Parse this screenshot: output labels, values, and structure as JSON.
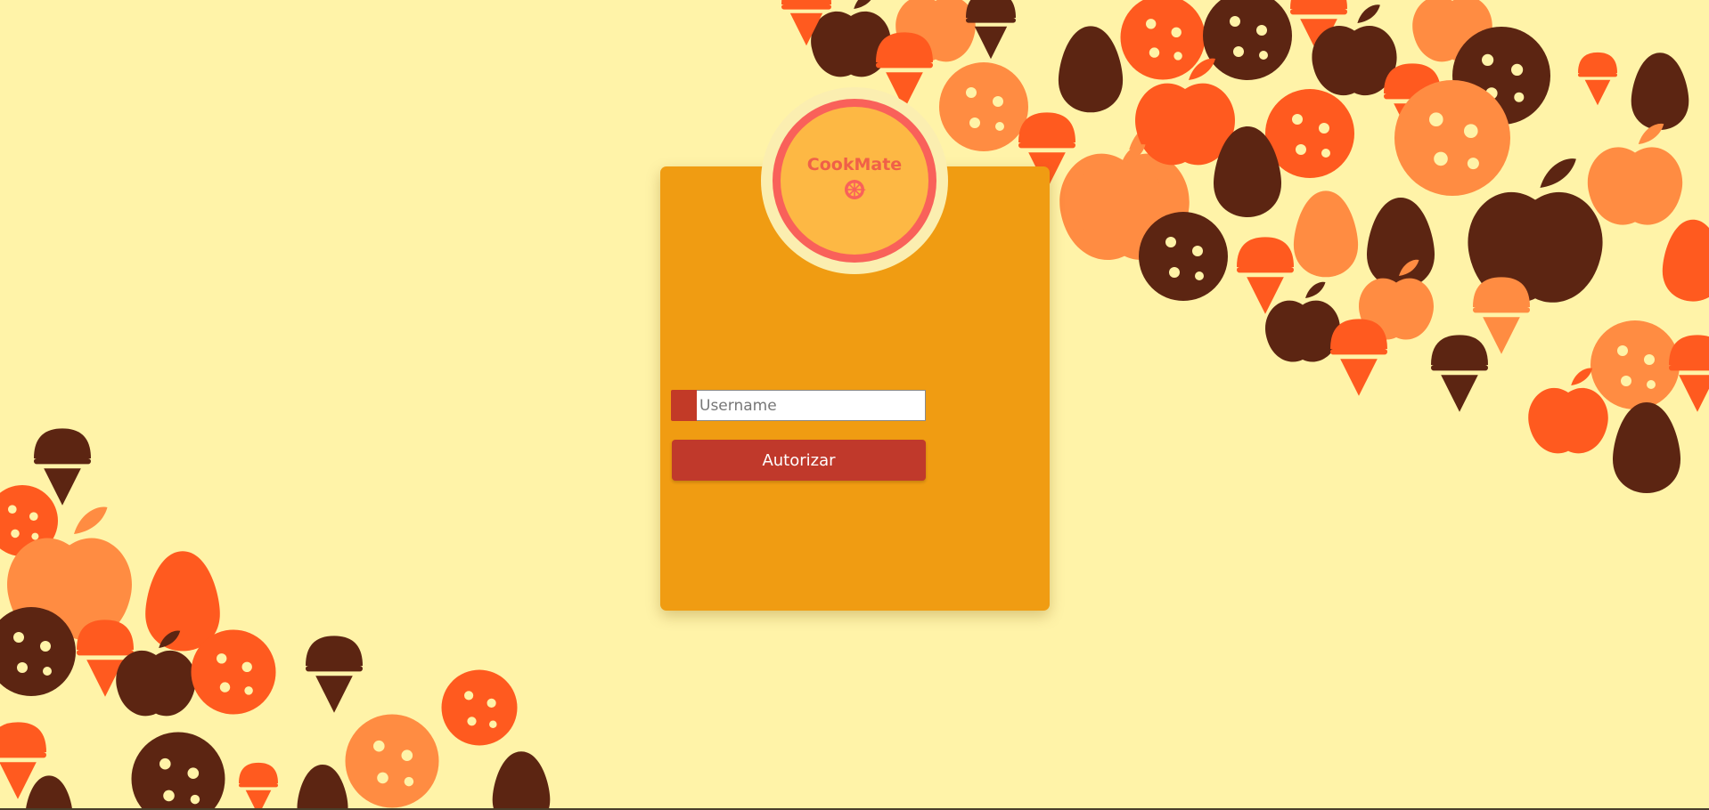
{
  "app": {
    "logo_text": "CookMate",
    "logo_icon": "lemon-slice-icon"
  },
  "login": {
    "username_placeholder": "Username",
    "username_value": "",
    "submit_label": "Autorizar"
  },
  "colors": {
    "background": "#fff3a8",
    "card": "#f09c12",
    "accent_red": "#c0392b",
    "logo_ring": "#f9615a",
    "logo_fill": "#fdb844",
    "dark_brown": "#5c2512",
    "orange": "#ff5a1f",
    "light_orange": "#ff8c42"
  },
  "decoration": {
    "shapes": [
      "ice-cream-cone-icon",
      "cookie-icon",
      "apple-icon",
      "egg-icon"
    ]
  }
}
